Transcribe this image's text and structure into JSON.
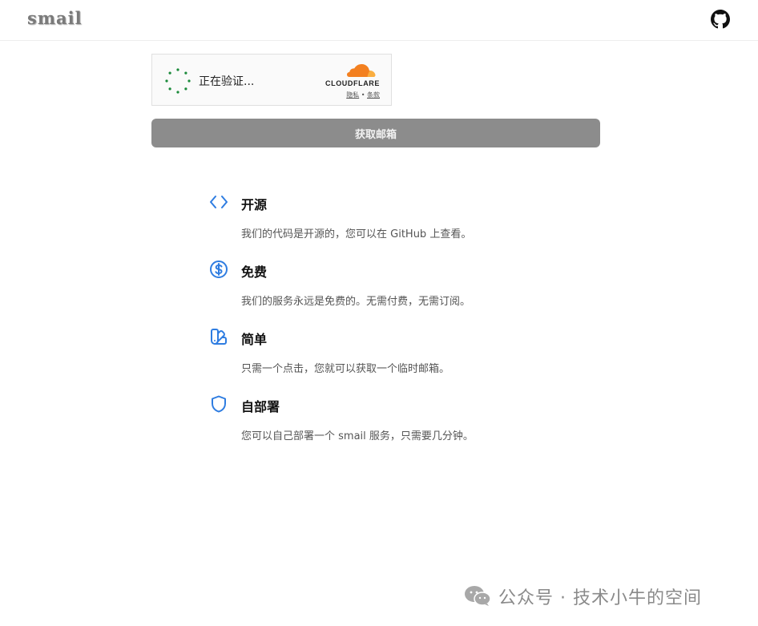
{
  "header": {
    "logo": "smail",
    "github_icon": "github-icon"
  },
  "captcha": {
    "status": "正在验证...",
    "brand": "CLOUDFLARE",
    "privacy_link": "隐私",
    "separator": "•",
    "terms_link": "条款",
    "brand_color": "#f38020",
    "spinner_color": "#1a8a3a"
  },
  "main": {
    "get_mailbox_button": "获取邮箱",
    "accent_color": "#2f7de1"
  },
  "features": [
    {
      "icon": "code-brackets-icon",
      "title": "开源",
      "desc": "我们的代码是开源的，您可以在 GitHub 上查看。"
    },
    {
      "icon": "dollar-circle-icon",
      "title": "免费",
      "desc": "我们的服务永远是免费的。无需付费，无需订阅。"
    },
    {
      "icon": "swatch-book-icon",
      "title": "简单",
      "desc": "只需一个点击，您就可以获取一个临时邮箱。"
    },
    {
      "icon": "shield-icon",
      "title": "自部署",
      "desc": "您可以自己部署一个 smail 服务，只需要几分钟。"
    }
  ],
  "watermark": {
    "text": "公众号 · 技术小牛的空间",
    "icon": "wechat-icon"
  }
}
